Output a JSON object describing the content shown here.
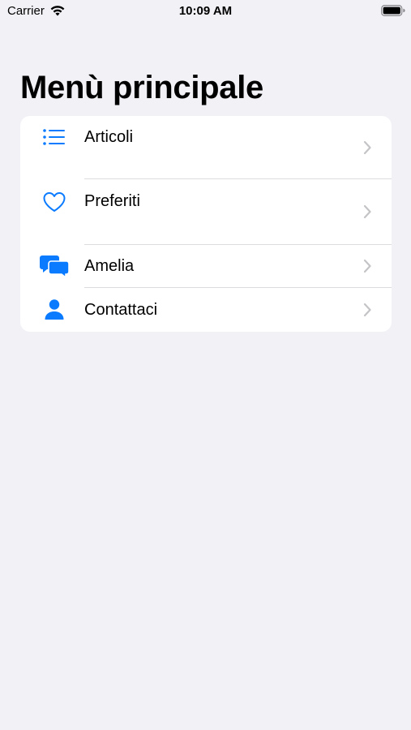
{
  "status_bar": {
    "carrier": "Carrier",
    "time": "10:09 AM",
    "wifi_icon": "wifi-icon",
    "battery_icon": "battery-icon"
  },
  "header": {
    "title": "Menù principale"
  },
  "menu": {
    "items": [
      {
        "label": "Articoli",
        "icon": "list-icon"
      },
      {
        "label": "Preferiti",
        "icon": "heart-icon"
      },
      {
        "label": "Amelia",
        "icon": "chat-bubbles-icon"
      },
      {
        "label": "Contattaci",
        "icon": "person-icon"
      }
    ],
    "chevron_icon": "chevron-right-icon"
  },
  "colors": {
    "accent": "#0a7aff",
    "background": "#f2f1f6",
    "card": "#ffffff",
    "chevron": "#c4c4c7",
    "divider": "#dcdce0"
  }
}
